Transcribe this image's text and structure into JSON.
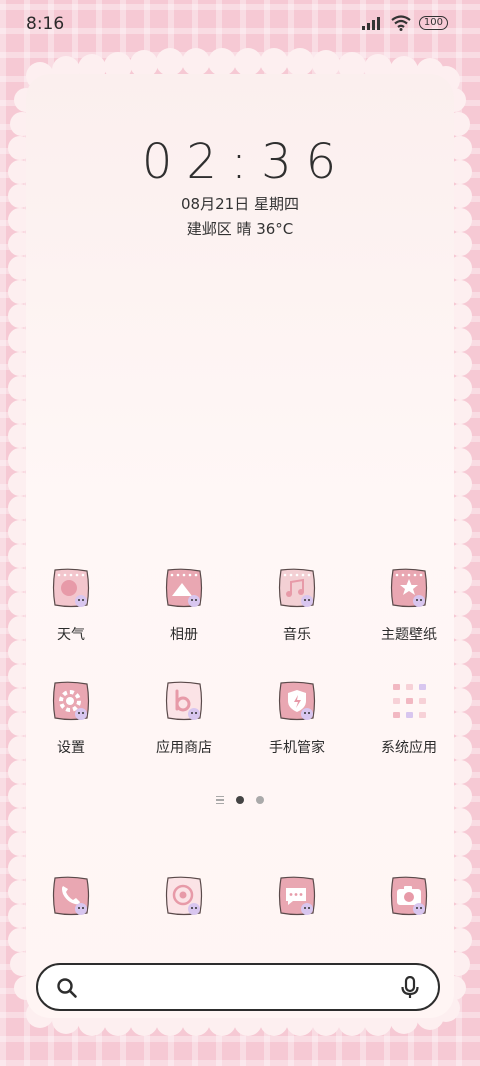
{
  "status_bar": {
    "time": "8:16",
    "battery": "100"
  },
  "lockscreen": {
    "time": "02:36",
    "date": "08月21日 星期四",
    "weather": "建邺区 晴 36°C"
  },
  "apps": [
    {
      "label": "天气",
      "icon": "weather-icon"
    },
    {
      "label": "相册",
      "icon": "gallery-icon"
    },
    {
      "label": "音乐",
      "icon": "music-icon"
    },
    {
      "label": "主题壁纸",
      "icon": "themes-icon"
    },
    {
      "label": "设置",
      "icon": "settings-icon"
    },
    {
      "label": "应用商店",
      "icon": "app-store-icon"
    },
    {
      "label": "手机管家",
      "icon": "security-icon"
    },
    {
      "label": "系统应用",
      "icon": "folder-icon"
    }
  ],
  "dock": [
    {
      "icon": "phone-icon"
    },
    {
      "icon": "browser-icon"
    },
    {
      "icon": "messages-icon"
    },
    {
      "icon": "camera-icon"
    }
  ],
  "colors": {
    "accent": "#e79aa8",
    "background": "#f6c9d4"
  }
}
